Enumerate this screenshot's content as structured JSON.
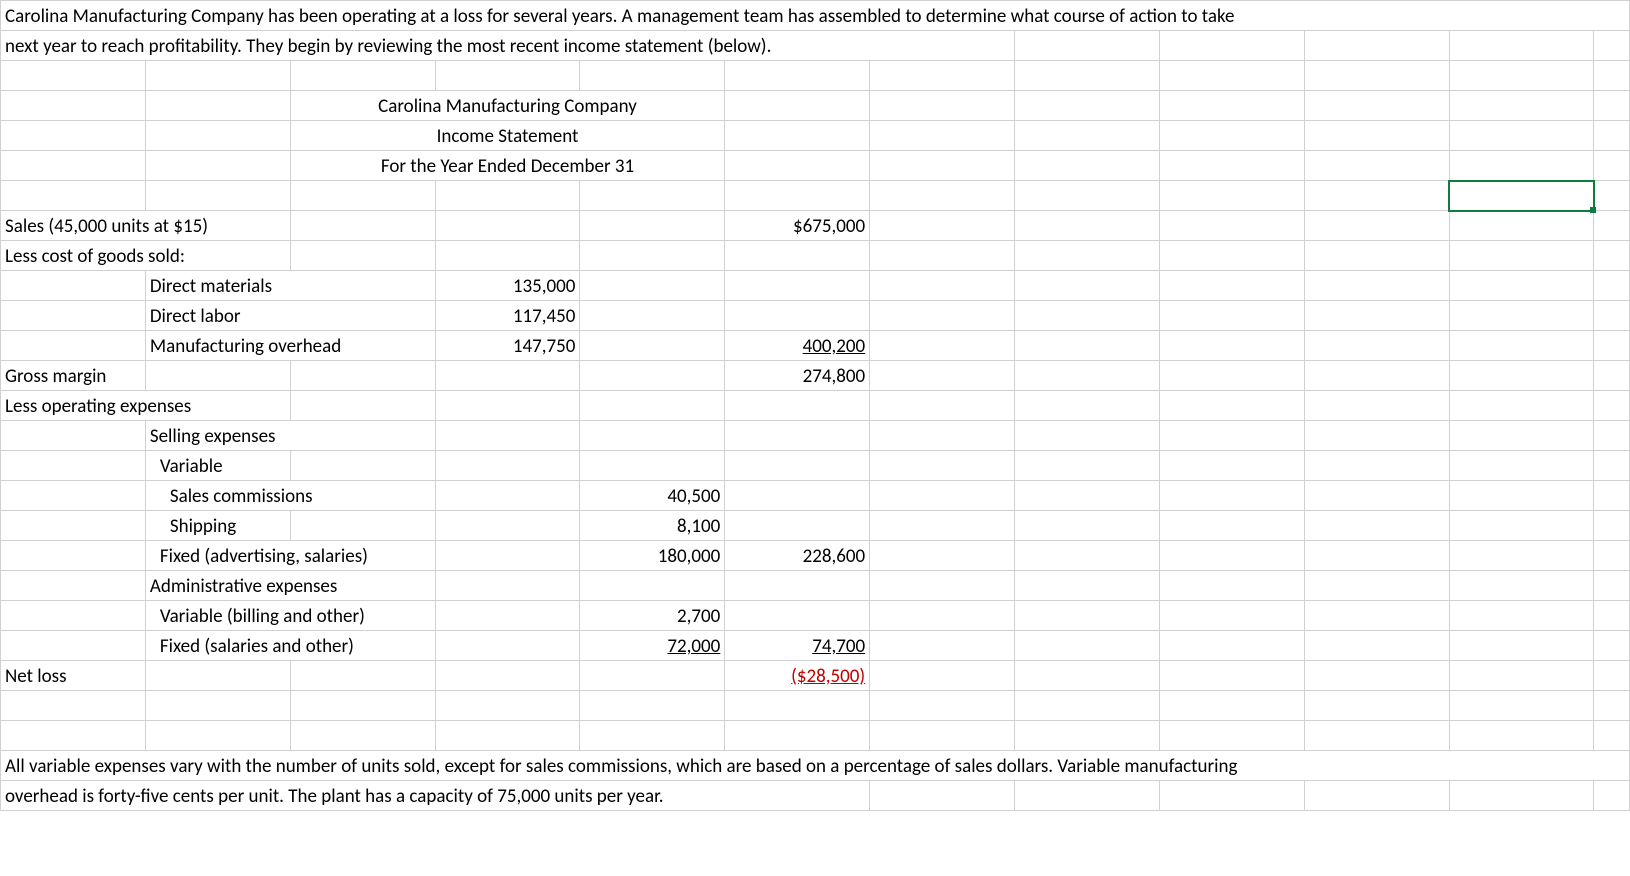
{
  "intro": {
    "line1": "Carolina Manufacturing Company has been operating at a loss for several years.  A management team has assembled to determine what course of action to take",
    "line2": "next year to reach profitability. They begin by reviewing the most recent income statement (below)."
  },
  "header": {
    "company": "Carolina Manufacturing Company",
    "title": "Income Statement",
    "period": "For the Year Ended December 31"
  },
  "rows": {
    "sales_label": "Sales (45,000 units at $15)",
    "sales_amount": "$675,000",
    "less_cogs": "Less cost of goods sold:",
    "dm_label": "Direct materials",
    "dm_val": "135,000",
    "dl_label": "Direct labor",
    "dl_val": "117,450",
    "moh_label": "Manufacturing overhead",
    "moh_val": "147,750",
    "cogs_total": "400,200",
    "gm_label": "Gross margin",
    "gm_val": "274,800",
    "less_opex": "Less operating expenses",
    "selling_label": "Selling expenses",
    "variable_label": "Variable",
    "commissions_label": "Sales commissions",
    "commissions_val": "40,500",
    "shipping_label": "Shipping",
    "shipping_val": "8,100",
    "fixed_sell_label": "Fixed (advertising, salaries)",
    "fixed_sell_val": "180,000",
    "selling_total": "228,600",
    "admin_label": "Administrative expenses",
    "var_admin_label": "Variable (billing and other)",
    "var_admin_val": "2,700",
    "fixed_admin_label": "Fixed (salaries and other)",
    "fixed_admin_val": "72,000",
    "admin_total": "74,700",
    "netloss_label": "Net loss",
    "netloss_val": "($28,500)"
  },
  "footer": {
    "line1": "All variable expenses vary with the number of units sold, except for sales commissions, which are based on a percentage of sales dollars. Variable manufacturing",
    "line2": "overhead is forty-five cents per unit. The plant has a capacity of 75,000 units per year."
  }
}
